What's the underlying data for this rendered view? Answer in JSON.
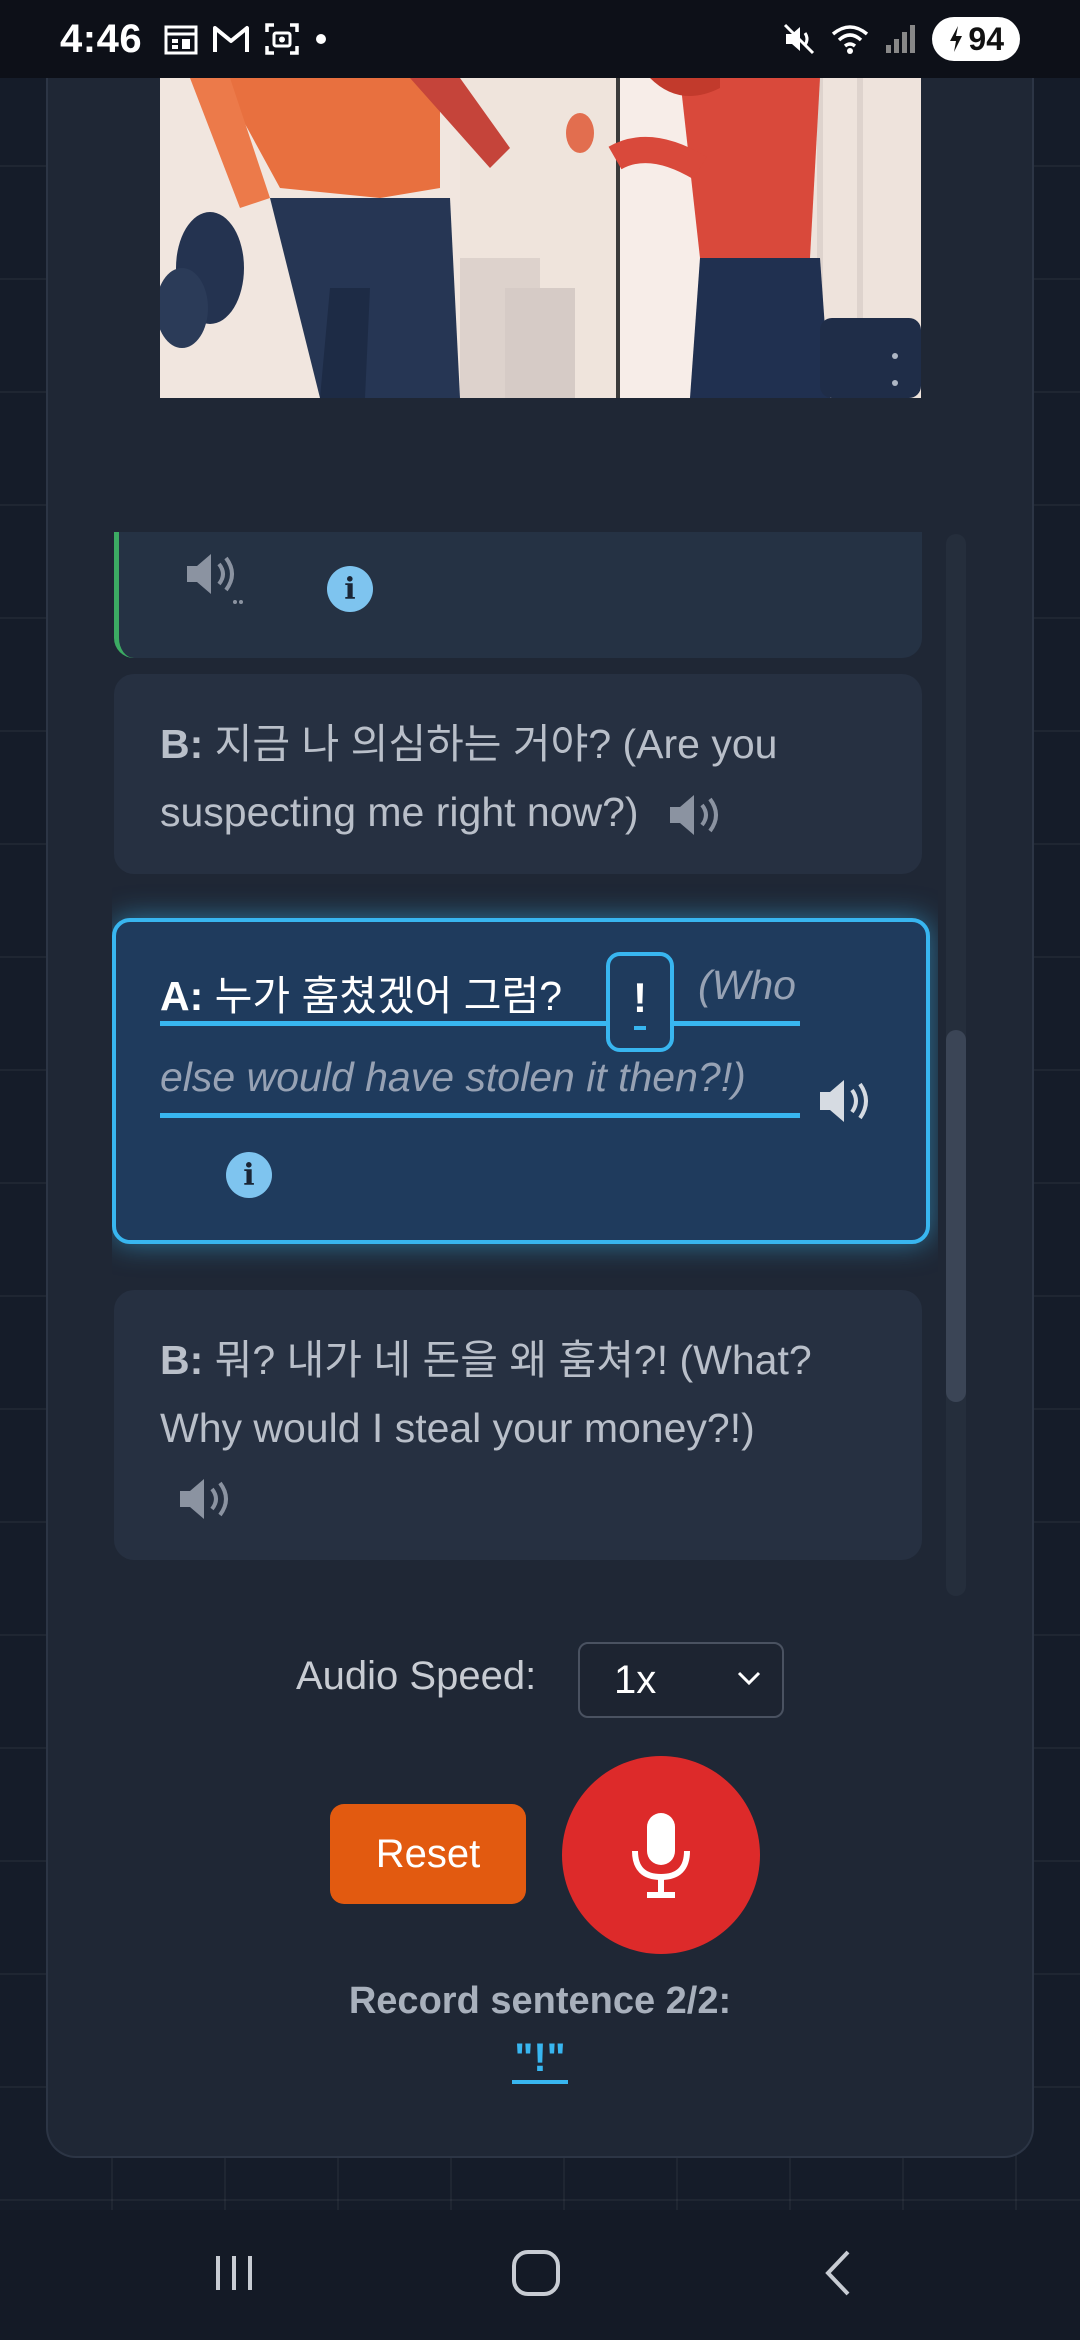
{
  "status_bar": {
    "time": "4:46",
    "left_icons": [
      "calendar-icon",
      "gmail-icon",
      "screenshot-icon",
      "dot-icon"
    ],
    "right_icons": [
      "mute-icon",
      "wifi-icon",
      "signal-icon"
    ],
    "battery": "94"
  },
  "dialogue": {
    "previous_line": {
      "audio_icon": "speaker-icon",
      "info_icon": "info-icon"
    },
    "lines": [
      {
        "speaker": "B:",
        "text": "지금 나 의심하는 거야? (Are you suspecting me right now?)"
      },
      {
        "speaker": "A:",
        "korean": "누가 훔쳤겠어 그럼?",
        "blank": "!",
        "english_part1": "(Who",
        "english_part2": "else would have stolen it then?!)"
      },
      {
        "speaker": "B:",
        "text": "뭐? 내가 네 돈을 왜 훔쳐?! (What? Why would I steal your money?!)"
      }
    ],
    "scroll_fraction": 0.47
  },
  "controls": {
    "speed_label": "Audio Speed:",
    "speed_value": "1x",
    "reset_label": "Reset",
    "record_label": "Record sentence 2/2:",
    "record_target": "\"!\""
  },
  "nav": {
    "items": [
      "recent-apps-icon",
      "home-icon",
      "back-icon"
    ]
  },
  "colors": {
    "accent": "#38b6f0",
    "reset": "#e25a10",
    "mic": "#dd2a2a",
    "correct": "#3cab63"
  }
}
